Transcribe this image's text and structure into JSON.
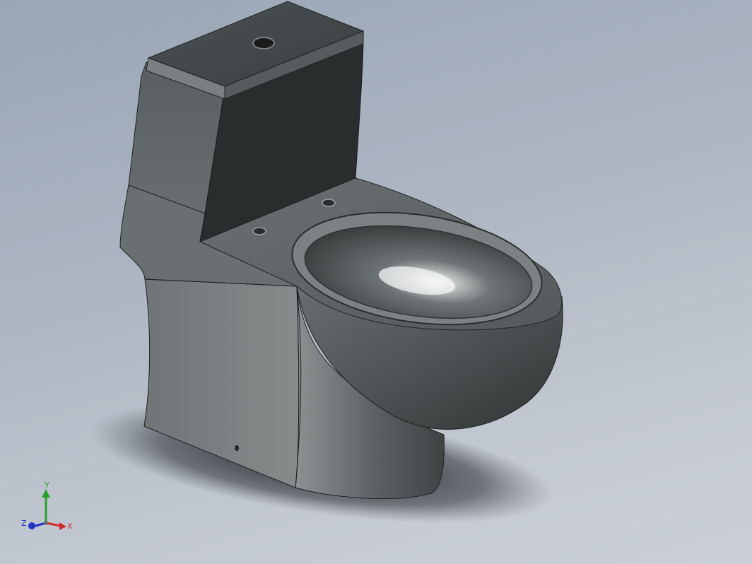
{
  "viewport": {
    "background_top": "#9aa6b6",
    "background_bottom": "#cbd0d8"
  },
  "model": {
    "object": "toilet-icon",
    "body_color": "#4b5153",
    "tank_front_color": "#2a2d2d",
    "highlight_color": "#f4f6f7"
  },
  "triad": {
    "x_label": "X",
    "y_label": "Y",
    "z_label": "Z",
    "x_color": "#d12a2a",
    "y_color": "#2aa12a",
    "z_color": "#1f35c4"
  }
}
